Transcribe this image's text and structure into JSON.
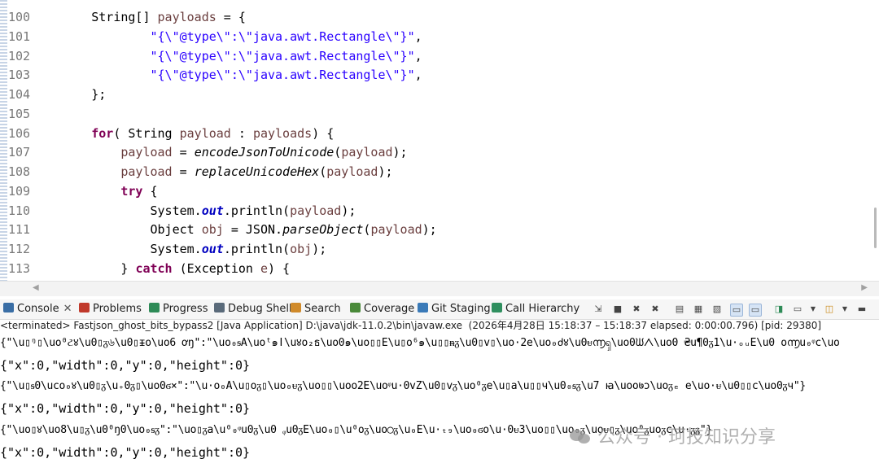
{
  "editor": {
    "lines": [
      {
        "num": "100",
        "segs": [
          {
            "t": "        String[] ",
            "c": ""
          },
          {
            "t": "payloads",
            "c": "var"
          },
          {
            "t": " = {",
            "c": ""
          }
        ]
      },
      {
        "num": "101",
        "segs": [
          {
            "t": "                ",
            "c": ""
          },
          {
            "t": "\"{\\\"@type\\\":\\\"java.awt.Rectangle\\\"}\"",
            "c": "str"
          },
          {
            "t": ",",
            "c": ""
          }
        ]
      },
      {
        "num": "102",
        "segs": [
          {
            "t": "                ",
            "c": ""
          },
          {
            "t": "\"{\\\"@type\\\":\\\"java.awt.Rectangle\\\"}\"",
            "c": "str"
          },
          {
            "t": ",",
            "c": ""
          }
        ]
      },
      {
        "num": "103",
        "segs": [
          {
            "t": "                ",
            "c": ""
          },
          {
            "t": "\"{\\\"@type\\\":\\\"java.awt.Rectangle\\\"}\"",
            "c": "str"
          },
          {
            "t": ",",
            "c": ""
          }
        ]
      },
      {
        "num": "104",
        "segs": [
          {
            "t": "        };",
            "c": ""
          }
        ]
      },
      {
        "num": "105",
        "segs": []
      },
      {
        "num": "106",
        "segs": [
          {
            "t": "        ",
            "c": ""
          },
          {
            "t": "for",
            "c": "kw"
          },
          {
            "t": "( String ",
            "c": ""
          },
          {
            "t": "payload",
            "c": "var"
          },
          {
            "t": " : ",
            "c": ""
          },
          {
            "t": "payloads",
            "c": "var"
          },
          {
            "t": ") {",
            "c": ""
          }
        ]
      },
      {
        "num": "107",
        "segs": [
          {
            "t": "            ",
            "c": ""
          },
          {
            "t": "payload",
            "c": "var"
          },
          {
            "t": " = ",
            "c": ""
          },
          {
            "t": "encodeJsonToUnicode",
            "c": "mth"
          },
          {
            "t": "(",
            "c": ""
          },
          {
            "t": "payload",
            "c": "var"
          },
          {
            "t": ");",
            "c": ""
          }
        ]
      },
      {
        "num": "108",
        "segs": [
          {
            "t": "            ",
            "c": ""
          },
          {
            "t": "payload",
            "c": "var"
          },
          {
            "t": " = ",
            "c": ""
          },
          {
            "t": "replaceUnicodeHex",
            "c": "mth"
          },
          {
            "t": "(",
            "c": ""
          },
          {
            "t": "payload",
            "c": "var"
          },
          {
            "t": ");",
            "c": ""
          }
        ]
      },
      {
        "num": "109",
        "segs": [
          {
            "t": "            ",
            "c": ""
          },
          {
            "t": "try",
            "c": "kw"
          },
          {
            "t": " {",
            "c": ""
          }
        ]
      },
      {
        "num": "110",
        "segs": [
          {
            "t": "                System.",
            "c": ""
          },
          {
            "t": "out",
            "c": "fld"
          },
          {
            "t": ".println(",
            "c": ""
          },
          {
            "t": "payload",
            "c": "var"
          },
          {
            "t": ");",
            "c": ""
          }
        ]
      },
      {
        "num": "111",
        "segs": [
          {
            "t": "                Object ",
            "c": ""
          },
          {
            "t": "obj",
            "c": "var"
          },
          {
            "t": " = JSON.",
            "c": ""
          },
          {
            "t": "parseObject",
            "c": "mth"
          },
          {
            "t": "(",
            "c": ""
          },
          {
            "t": "payload",
            "c": "var"
          },
          {
            "t": ");",
            "c": ""
          }
        ]
      },
      {
        "num": "112",
        "segs": [
          {
            "t": "                System.",
            "c": ""
          },
          {
            "t": "out",
            "c": "fld"
          },
          {
            "t": ".println(",
            "c": ""
          },
          {
            "t": "obj",
            "c": "var"
          },
          {
            "t": ");",
            "c": ""
          }
        ]
      },
      {
        "num": "113",
        "segs": [
          {
            "t": "            } ",
            "c": ""
          },
          {
            "t": "catch",
            "c": "kw"
          },
          {
            "t": " (Exception ",
            "c": ""
          },
          {
            "t": "e",
            "c": "var"
          },
          {
            "t": ") {",
            "c": ""
          }
        ]
      }
    ]
  },
  "tabs": [
    {
      "label": "Console",
      "icon": "console-icon",
      "color": "#3a6ea5",
      "active": true
    },
    {
      "label": "Problems",
      "icon": "problems-icon",
      "color": "#c0392b"
    },
    {
      "label": "Progress",
      "icon": "progress-icon",
      "color": "#2e8b57"
    },
    {
      "label": "Debug Shell",
      "icon": "debug-shell-icon",
      "color": "#5a6a7a"
    },
    {
      "label": "Search",
      "icon": "search-icon",
      "color": "#d08a2a"
    },
    {
      "label": "Coverage",
      "icon": "coverage-icon",
      "color": "#4a8a3a"
    },
    {
      "label": "Git Staging",
      "icon": "git-staging-icon",
      "color": "#3a7ab8"
    },
    {
      "label": "Call Hierarchy",
      "icon": "call-hierarchy-icon",
      "color": "#2f8f5f"
    }
  ],
  "console": {
    "status": "<terminated> Fastjson_ghost_bits_bypass2 [Java Application] D:\\java\\jdk-11.0.2\\bin\\javaw.exe  (2026年4月28日 15:18:37 – 15:18:37 elapsed: 0:00:00.796) [pid: 29380]",
    "outputs": [
      {
        "text": "{\"\\u▯ᵑ▯\\uo⁰ટ४\\u0▯ᵹ৬\\u0▯ᵻo\\uo6 ơ​ŋ\":\"\\uo₀ᵴA\\uoᵗ๑ǀ\\u४o₂ธ\\uo0๑\\uo▯▯E\\u▯o⁶๑\\u▯▯ᵰᵹ\\u0▯v▯\\uo·2e\\uo₀ძ४\\u0ᵾ൬ၡ\\uo0ᙎᐱ\\uo0 ₴u¶0ᵹ1\\u·ₒᵤE\\u0 o൬u₀ᵠc\\uo",
        "garbled": true
      },
      {
        "text": "{\"x\":0,\"width\":0,\"y\":0,\"height\":0}",
        "garbled": false
      },
      {
        "text": "{\"\\u▯ᵴ0\\uco₀४\\u0▯ᵹ\\u₊0ᵹ▯\\uo0ϭ×\":\"\\u·o₀A\\u▯oᵹ▯\\uo₀ᵾᵹ\\uo▯▯\\uoo2E\\uoᵠu·0vZ\\u0▯vᵹ\\uo⁰ᵹe\\u▯a\\u▯▯ч\\u0₀ᵴᵹ\\u7 ꙗ\\uoo७ɔ\\uoᵹₑ e\\uo·ᵾ\\u0▯▯c\\uo0ᵹч\"}",
        "garbled": true
      },
      {
        "text": "{\"x\":0,\"width\":0,\"y\":0,\"height\":0}",
        "garbled": false
      },
      {
        "text": "{\"\\uo▯४\\uo8\\u▯ᵹ\\u0⁰ŋ0\\uo₀ᵴᵹ\":\"\\uo▯ᵹa\\u⁰₀ᵠu0ᵹ\\u0 ᵩu0ᵹE\\uo₀▯\\u⁰oᵹ\\uo◯ᵹ\\u₀E\\u·ₜ₉\\uo₀ϭo\\u·0ᵾ3\\uo▯▯\\uo₀ᵹ\\uoᵾ▯ᵹ\\uo⁰ᵹuoᵹc\\u·ᵹᵹ\"}",
        "garbled": true
      },
      {
        "text": "{\"x\":0,\"width\":0,\"y\":0,\"height\":0}",
        "garbled": false
      }
    ]
  },
  "watermark": {
    "text": "公众号 · 珂技知识分享"
  }
}
